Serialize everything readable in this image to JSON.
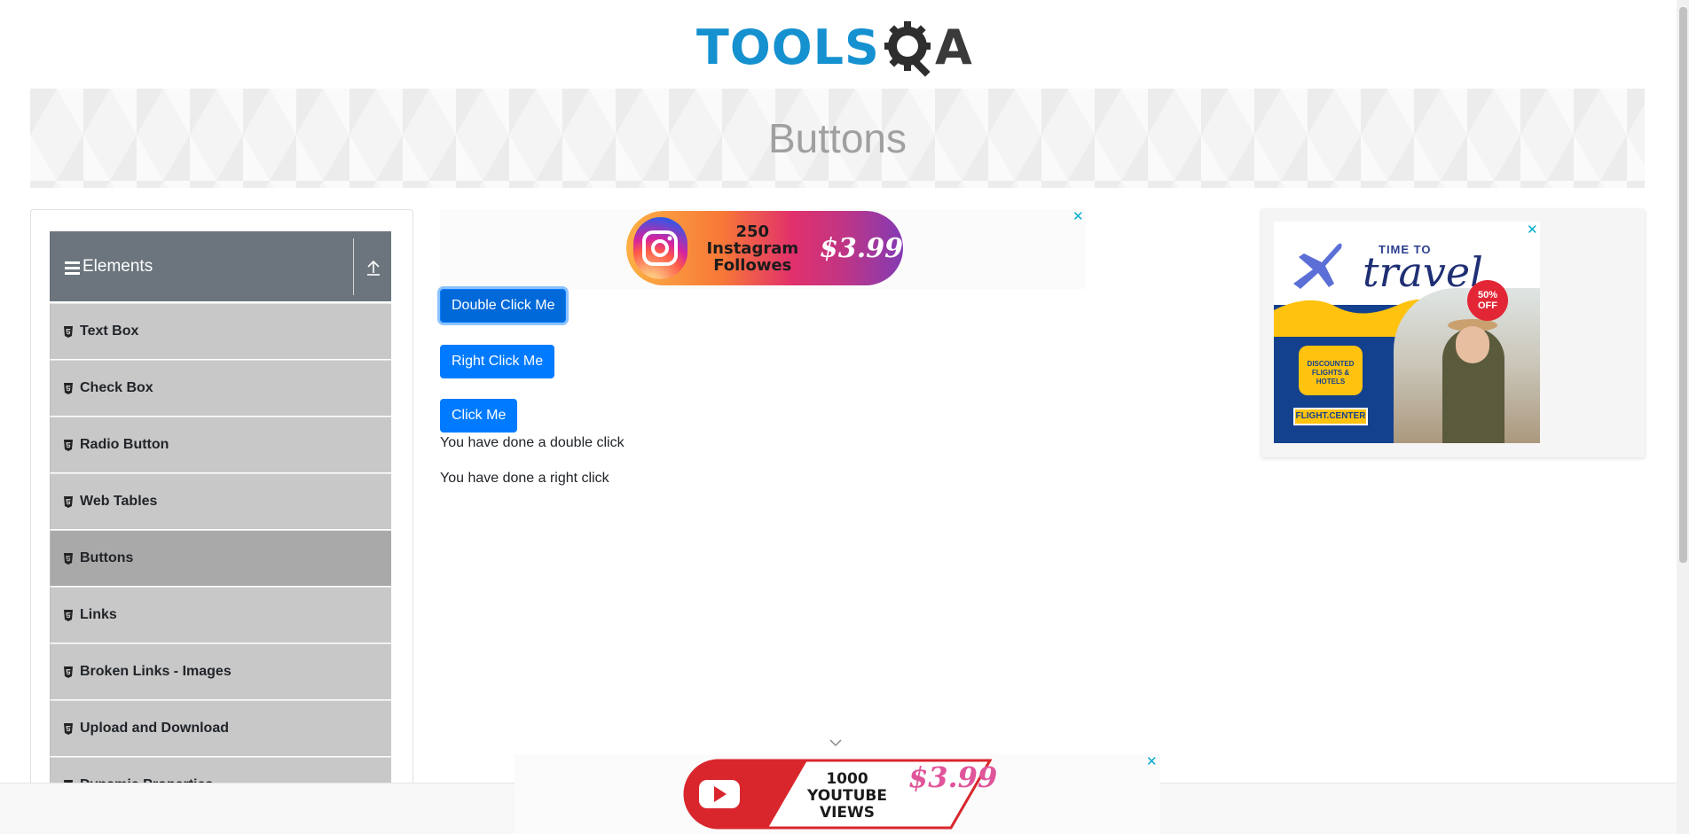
{
  "logo": {
    "text_part": "TOOLS",
    "text_tail": "A"
  },
  "banner": {
    "title": "Buttons"
  },
  "sidebar": {
    "group_title": "Elements",
    "items": [
      {
        "label": "Text Box"
      },
      {
        "label": "Check Box"
      },
      {
        "label": "Radio Button"
      },
      {
        "label": "Web Tables"
      },
      {
        "label": "Buttons",
        "active": true
      },
      {
        "label": "Links"
      },
      {
        "label": "Broken Links - Images"
      },
      {
        "label": "Upload and Download"
      },
      {
        "label": "Dynamic Properties"
      }
    ]
  },
  "main": {
    "double_click_label": "Double Click Me",
    "right_click_label": "Right Click Me",
    "click_label": "Click Me",
    "double_click_message": "You have done a double click",
    "right_click_message": "You have done a right click"
  },
  "ads": {
    "top": {
      "line1": "250 Instagram",
      "line2": "Followes",
      "price": "$3.99"
    },
    "right": {
      "small": "TIME TO",
      "big": "travel",
      "badge_line1": "50%",
      "badge_line2": "OFF",
      "bubble_line1": "DISCOUNTED",
      "bubble_line2": "FLIGHTS & HOTELS",
      "brand": "FLIGHT.CENTER"
    },
    "bottom": {
      "line1": "1000",
      "line2": "YOUTUBE VIEWS",
      "price": "$3.99"
    },
    "close_glyph": "✕"
  },
  "colors": {
    "primary": "#007bff",
    "sidebar_header": "#6c757d",
    "sidebar_item": "#c8c8c8",
    "sidebar_active": "#a9a9a9",
    "logo_blue": "#1591d0"
  }
}
